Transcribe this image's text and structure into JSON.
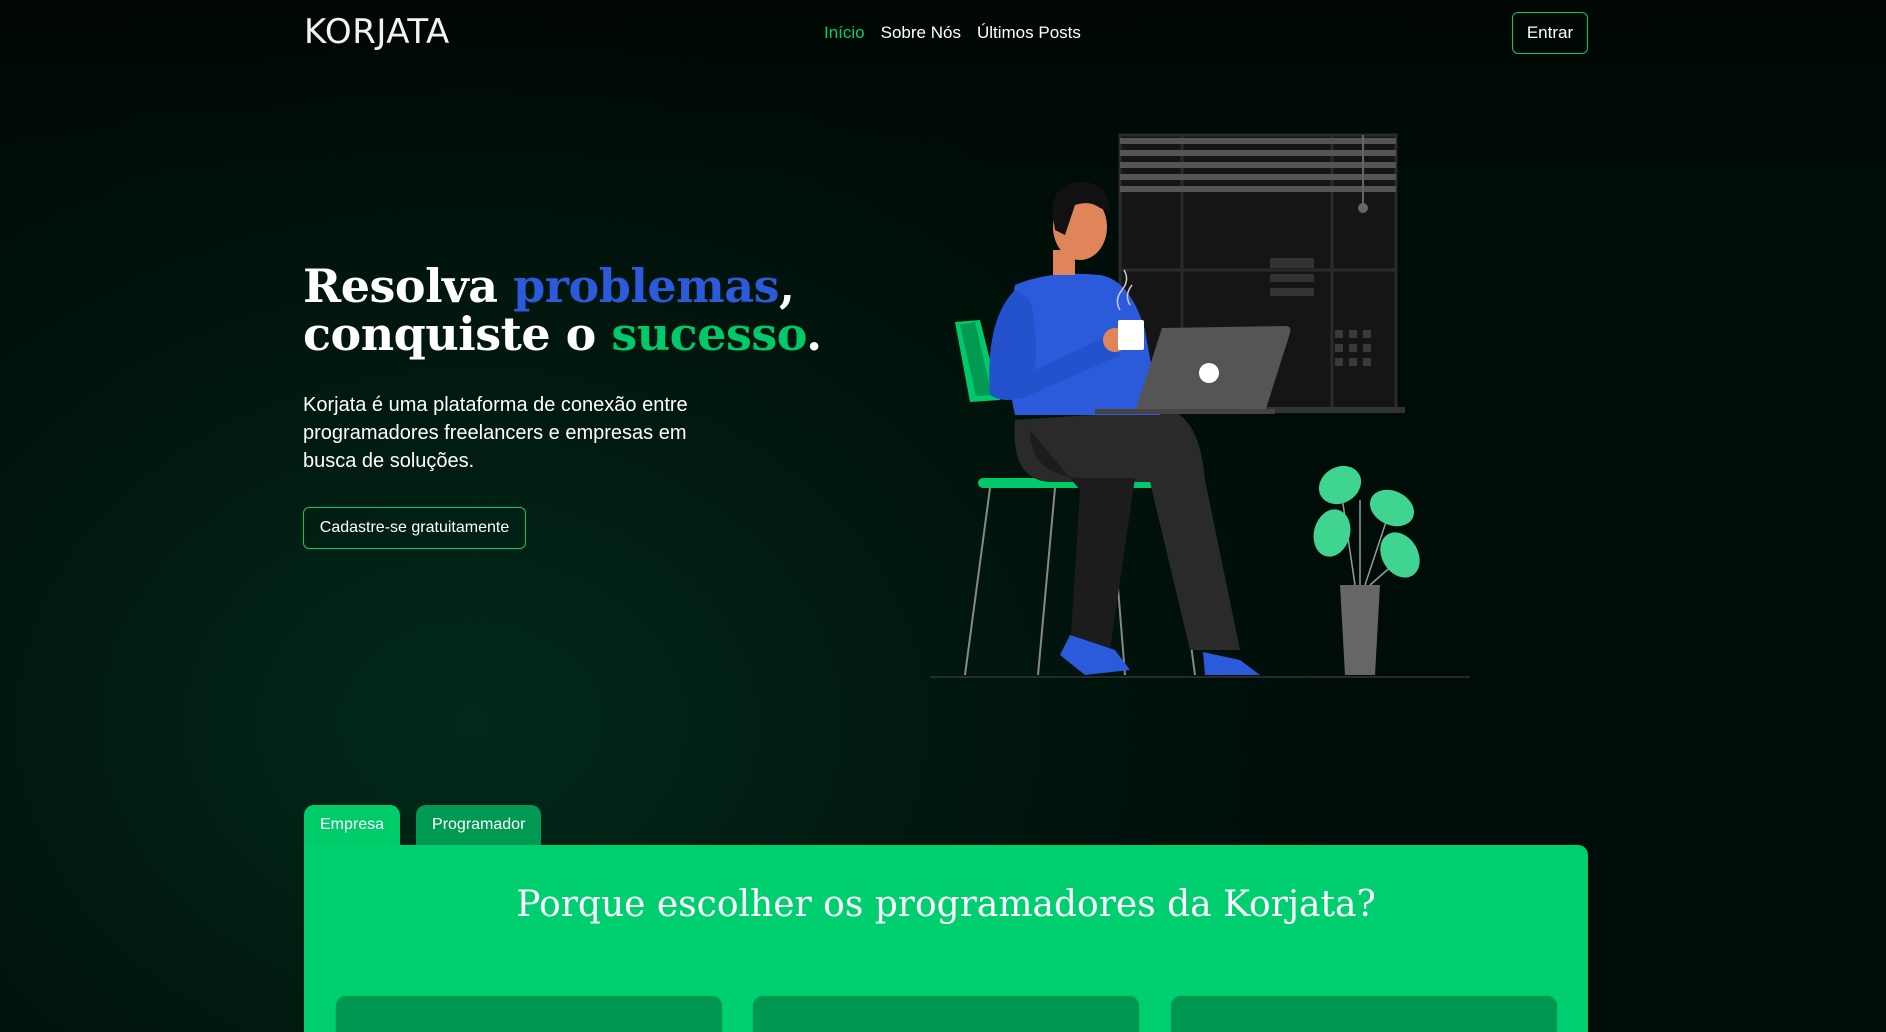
{
  "navbar": {
    "brand": "KORJATA",
    "links": [
      {
        "label": "Início",
        "active": true
      },
      {
        "label": "Sobre Nós",
        "active": false
      },
      {
        "label": "Últimos Posts",
        "active": false
      }
    ],
    "login_label": "Entrar"
  },
  "hero": {
    "title_part1": "Resolva ",
    "title_highlight1": "problemas",
    "title_part2": ",",
    "title_part3": "conquiste o ",
    "title_highlight2": "sucesso",
    "title_part4": ".",
    "description": "Korjata é uma plataforma de conexão entre programadores freelancers e empresas em busca de soluções.",
    "cta_label": "Cadastre-se gratuitamente"
  },
  "tabs": [
    {
      "label": "Empresa",
      "active": true
    },
    {
      "label": "Programador",
      "active": false
    }
  ],
  "panel": {
    "title": "Porque escolher os programadores da Korjata?",
    "cards": 3
  },
  "colors": {
    "accent_green": "#00cc6a",
    "accent_blue": "#2b5bdb",
    "background": "#011a10"
  }
}
